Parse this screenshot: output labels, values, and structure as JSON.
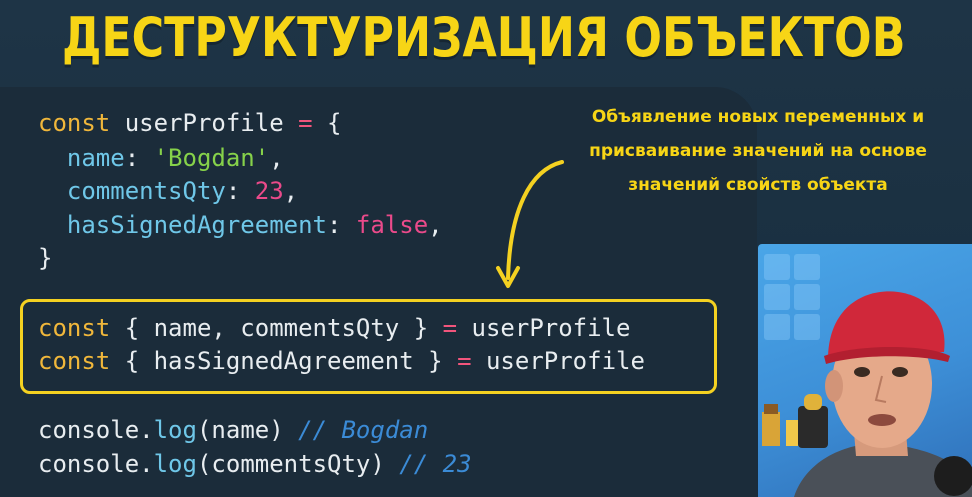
{
  "title": "ДЕСТРУКТУРИЗАЦИЯ ОБЪЕКТОВ",
  "note": {
    "line1": "Объявление новых переменных и",
    "line2": "присваивание значений на основе",
    "line3": "значений свойств объекта"
  },
  "code": {
    "obj_decl": {
      "kw": "const",
      "name": "userProfile",
      "eq": "=",
      "brace": "{"
    },
    "props": [
      {
        "key": "name",
        "value": "'Bogdan'",
        "type": "string"
      },
      {
        "key": "commentsQty",
        "value": "23",
        "type": "number"
      },
      {
        "key": "hasSignedAgreement",
        "value": "false",
        "type": "keyword"
      }
    ],
    "obj_close": "}",
    "destructure": [
      {
        "kw": "const",
        "open": "{",
        "vars": "name, commentsQty",
        "close": "}",
        "eq": "=",
        "source": "userProfile"
      },
      {
        "kw": "const",
        "open": "{",
        "vars": "hasSignedAgreement",
        "close": "}",
        "eq": "=",
        "source": "userProfile"
      }
    ],
    "logs": [
      {
        "obj": "console",
        "method": "log",
        "arg": "name",
        "comment": "// Bogdan"
      },
      {
        "obj": "console",
        "method": "log",
        "arg": "commentsQty",
        "comment": "// 23"
      }
    ]
  },
  "colors": {
    "accent": "#f7d516",
    "background": "#1e3446",
    "panel": "#1b2c3a"
  },
  "icons": {
    "arrow": "curved-arrow-down-icon"
  }
}
